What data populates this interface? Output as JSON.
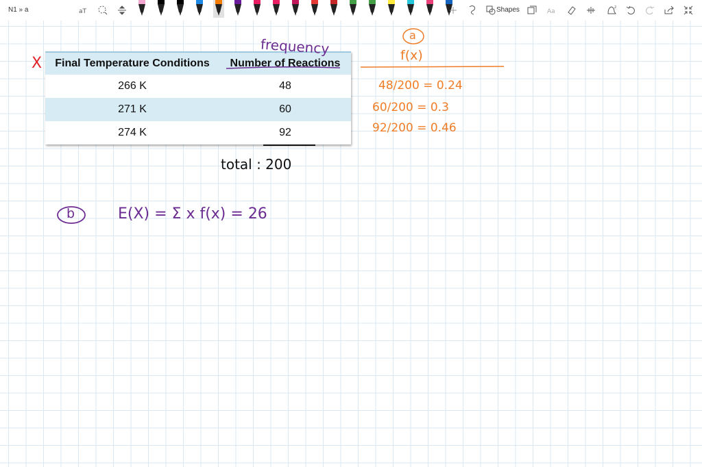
{
  "toolbar": {
    "breadcrumb": "N1 » a",
    "shapes_label": "Shapes",
    "pens": [
      {
        "color": "#f2a6cf"
      },
      {
        "color": "#000000"
      },
      {
        "color": "#000000"
      },
      {
        "color": "#1e88e5"
      },
      {
        "color": "#f57c00"
      },
      {
        "color": "#6a1b9a"
      },
      {
        "color": "#e91e63"
      },
      {
        "color": "#e91e63"
      },
      {
        "color": "#c2185b"
      },
      {
        "color": "#e53935"
      },
      {
        "color": "#c62828"
      },
      {
        "color": "#43a047"
      },
      {
        "color": "#43a047"
      },
      {
        "color": "#ffeb3b"
      },
      {
        "color": "#26c6da"
      },
      {
        "color": "#ec407a"
      },
      {
        "color": "#1565c0"
      }
    ]
  },
  "table": {
    "headers": [
      "Final Temperature Conditions",
      "Number of Reactions"
    ],
    "rows": [
      {
        "temp": "266 K",
        "count": "48"
      },
      {
        "temp": "271 K",
        "count": "60"
      },
      {
        "temp": "274 K",
        "count": "92"
      }
    ]
  },
  "ink": {
    "x_mark": "X",
    "frequency": "frequency",
    "total": "total : 200",
    "part_a": "a",
    "fx_header": "f(x)",
    "calcs": [
      "48/200 = 0.24",
      "60/200 = 0.3",
      "92/200 = 0.46"
    ],
    "part_b": "b",
    "expectation": "E(X) =  Σ  x f(x) =  26"
  },
  "colors": {
    "purple_ink": "#6b2c91",
    "orange_ink": "#ef7d27",
    "grid": "#d9e8f3",
    "table_band": "#d7ebf4"
  }
}
